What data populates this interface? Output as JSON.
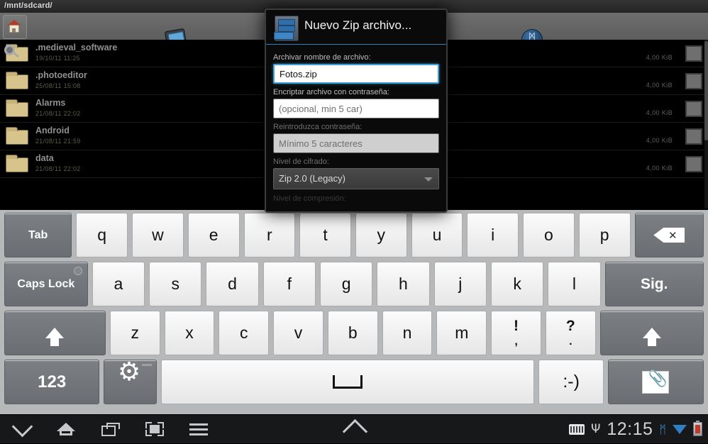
{
  "app": {
    "path_bar": "/mnt/sdcard/",
    "toolbar": {
      "home_icon": "home-icon",
      "sdcard_icon": "sdcard-icon",
      "bluetooth_icon": "bluetooth-icon",
      "bluetooth_glyph": "ᛗ"
    },
    "files": [
      {
        "name": ".medieval_software",
        "date": "19/10/11  11:25",
        "size": "4,00 KiB",
        "icon": "folder-search-icon",
        "checked": false
      },
      {
        "name": ".photoeditor",
        "date": "25/08/11  15:08",
        "size": "4,00 KiB",
        "icon": "folder-icon",
        "checked": false
      },
      {
        "name": "Alarms",
        "date": "21/08/11  22:02",
        "size": "4,00 KiB",
        "icon": "folder-icon",
        "checked": false
      },
      {
        "name": "Android",
        "date": "21/08/11  21:59",
        "size": "4,00 KiB",
        "icon": "folder-icon",
        "checked": false
      },
      {
        "name": "data",
        "date": "21/08/11  22:02",
        "size": "4,00 KiB",
        "icon": "folder-icon",
        "checked": false
      }
    ]
  },
  "dialog": {
    "title": "Nuevo Zip archivo...",
    "icon": "archive-cabinet-icon",
    "filename_label": "Archivar nombre de archivo:",
    "filename_value": "Fotos.zip",
    "password_label": "Encriptar archivo con contraseña:",
    "password_placeholder": "(opcional, min 5 car)",
    "password_value": "",
    "repeat_label": "Reintroduzca contraseña:",
    "repeat_placeholder": "Mínimo 5 caracteres",
    "repeat_value": "",
    "encryption_label": "Nivel de cifrado:",
    "encryption_value": "Zip 2.0 (Legacy)",
    "encryption_options": [
      "Zip 2.0 (Legacy)"
    ],
    "cut_off_label": "Nivel de compresión:",
    "accent_color": "#3f9fd8"
  },
  "keyboard": {
    "rows": [
      [
        {
          "label": "Tab",
          "name": "key-tab",
          "style": "dark",
          "flex": 1.32
        },
        {
          "label": "q",
          "name": "key-q",
          "style": "light",
          "flex": 1
        },
        {
          "label": "w",
          "name": "key-w",
          "style": "light",
          "flex": 1
        },
        {
          "label": "e",
          "name": "key-e",
          "style": "light",
          "flex": 1
        },
        {
          "label": "r",
          "name": "key-r",
          "style": "light",
          "flex": 1
        },
        {
          "label": "t",
          "name": "key-t",
          "style": "light",
          "flex": 1
        },
        {
          "label": "y",
          "name": "key-y",
          "style": "light",
          "flex": 1
        },
        {
          "label": "u",
          "name": "key-u",
          "style": "light",
          "flex": 1
        },
        {
          "label": "i",
          "name": "key-i",
          "style": "light",
          "flex": 1
        },
        {
          "label": "o",
          "name": "key-o",
          "style": "light",
          "flex": 1
        },
        {
          "label": "p",
          "name": "key-p",
          "style": "light",
          "flex": 1
        },
        {
          "label": "",
          "name": "key-backspace",
          "style": "dark",
          "flex": 1.35,
          "glyph": "backspace-icon"
        }
      ],
      [
        {
          "label": "Caps Lock",
          "name": "key-caps-lock",
          "style": "dark",
          "flex": 1.6,
          "led": true
        },
        {
          "label": "a",
          "name": "key-a",
          "style": "light",
          "flex": 1
        },
        {
          "label": "s",
          "name": "key-s",
          "style": "light",
          "flex": 1
        },
        {
          "label": "d",
          "name": "key-d",
          "style": "light",
          "flex": 1
        },
        {
          "label": "f",
          "name": "key-f",
          "style": "light",
          "flex": 1
        },
        {
          "label": "g",
          "name": "key-g",
          "style": "light",
          "flex": 1
        },
        {
          "label": "h",
          "name": "key-h",
          "style": "light",
          "flex": 1
        },
        {
          "label": "j",
          "name": "key-j",
          "style": "light",
          "flex": 1
        },
        {
          "label": "k",
          "name": "key-k",
          "style": "light",
          "flex": 1
        },
        {
          "label": "l",
          "name": "key-l",
          "style": "light",
          "flex": 1
        },
        {
          "label": "Sig.",
          "name": "key-enter-next",
          "style": "dark",
          "flex": 1.9,
          "fontsize": 21
        }
      ],
      [
        {
          "label": "",
          "name": "key-shift-left",
          "style": "dark",
          "flex": 2.05,
          "glyph": "arrow-up-icon"
        },
        {
          "label": "z",
          "name": "key-z",
          "style": "light",
          "flex": 1
        },
        {
          "label": "x",
          "name": "key-x",
          "style": "light",
          "flex": 1
        },
        {
          "label": "c",
          "name": "key-c",
          "style": "light",
          "flex": 1
        },
        {
          "label": "v",
          "name": "key-v",
          "style": "light",
          "flex": 1
        },
        {
          "label": "b",
          "name": "key-b",
          "style": "light",
          "flex": 1
        },
        {
          "label": "n",
          "name": "key-n",
          "style": "light",
          "flex": 1
        },
        {
          "label": "m",
          "name": "key-m",
          "style": "light",
          "flex": 1
        },
        {
          "label": "!",
          "sublabel": ",",
          "name": "key-exclam-comma",
          "style": "light",
          "flex": 1
        },
        {
          "label": "?",
          "sublabel": ".",
          "name": "key-question-period",
          "style": "light",
          "flex": 1
        },
        {
          "label": "",
          "name": "key-shift-right",
          "style": "dark",
          "flex": 2.1,
          "glyph": "arrow-up-icon"
        }
      ],
      [
        {
          "label": "123",
          "name": "key-numeric-mode",
          "style": "dark",
          "flex": 1.92,
          "fontsize": 24
        },
        {
          "label": "",
          "name": "key-settings",
          "style": "dark",
          "flex": 1.06,
          "glyph": "gear-icon"
        },
        {
          "label": "",
          "name": "key-space",
          "style": "light",
          "flex": 7.6,
          "glyph": "space-icon"
        },
        {
          "label": ":-)",
          "name": "key-emoticon",
          "style": "light",
          "flex": 1.3,
          "fontsize": 25
        },
        {
          "label": "",
          "name": "key-attachment",
          "style": "dark",
          "flex": 1.93,
          "glyph": "clip-icon"
        }
      ]
    ]
  },
  "navbar": {
    "back_icon": "chevron-down-back-icon",
    "home_icon": "home-icon",
    "recents_icon": "recent-apps-icon",
    "screenshot_icon": "screenshot-icon",
    "menu_icon": "menu-icon",
    "hide_keyboard_icon": "caret-up-icon",
    "status": {
      "keyboard_icon": "keyboard-icon",
      "usb_icon": "usb-icon",
      "usb_glyph": "Ψ",
      "clock": "12:15",
      "bluetooth_icon": "bluetooth-icon",
      "bluetooth_glyph": "ᛗ",
      "wifi_icon": "wifi-icon",
      "battery_icon": "battery-icon"
    }
  }
}
